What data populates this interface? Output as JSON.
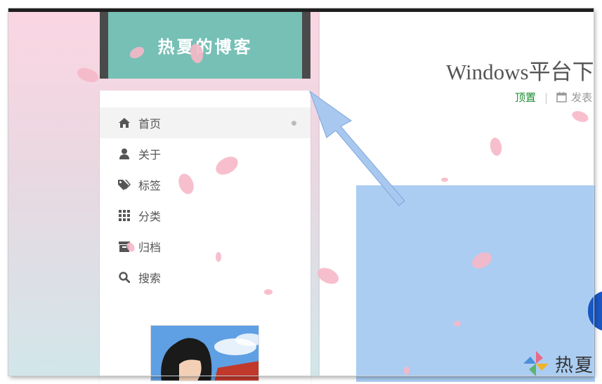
{
  "site": {
    "title": "热夏的博客"
  },
  "menu": {
    "items": [
      {
        "label": "首页",
        "icon": "home-icon",
        "active": true
      },
      {
        "label": "关于",
        "icon": "user-icon",
        "active": false
      },
      {
        "label": "标签",
        "icon": "tags-icon",
        "active": false
      },
      {
        "label": "分类",
        "icon": "grid-icon",
        "active": false
      },
      {
        "label": "归档",
        "icon": "archive-icon",
        "active": false
      },
      {
        "label": "搜索",
        "icon": "search-icon",
        "active": false
      }
    ]
  },
  "post": {
    "title": "Windows平台下",
    "pin_label": "顶置",
    "meta_separator": "|",
    "published_label": "发表"
  },
  "watermark": {
    "text": "热夏"
  },
  "colors": {
    "brand_bg": "#76c0b6",
    "brand_frame": "#4a4a4a",
    "pin_green": "#1e8c34",
    "arrow_blue": "#a8c8f0",
    "petal_pink": "#f6b8c8",
    "image_bg": "#abcdf2"
  }
}
